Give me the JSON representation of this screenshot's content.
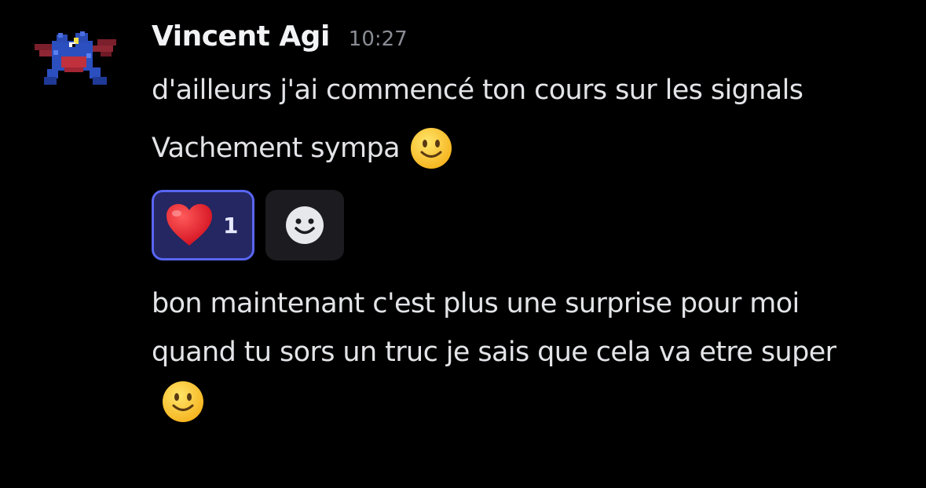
{
  "message": {
    "author": "Vincent Agi",
    "timestamp": "10:27",
    "avatar_icon": "pixel-blue-creature-avatar",
    "lines": [
      "d'ailleurs j'ai commencé ton cours sur les signals",
      "Vachement sympa",
      "bon maintenant c'est plus une surprise pour moi quand tu sors un truc je sais que cela va etre super"
    ],
    "inline_emoji": "slightly-smiling-face"
  },
  "reactions": [
    {
      "emoji": "red-heart",
      "count": "1",
      "selected": true
    }
  ],
  "add_reaction_icon": "smiley-add-reaction-icon",
  "colors": {
    "background": "#000000",
    "text": "#e3e4e8",
    "timestamp": "#8b8d95",
    "reaction_bg": "#242761",
    "reaction_border": "#5865f2",
    "add_reaction_bg": "#1c1c20"
  }
}
